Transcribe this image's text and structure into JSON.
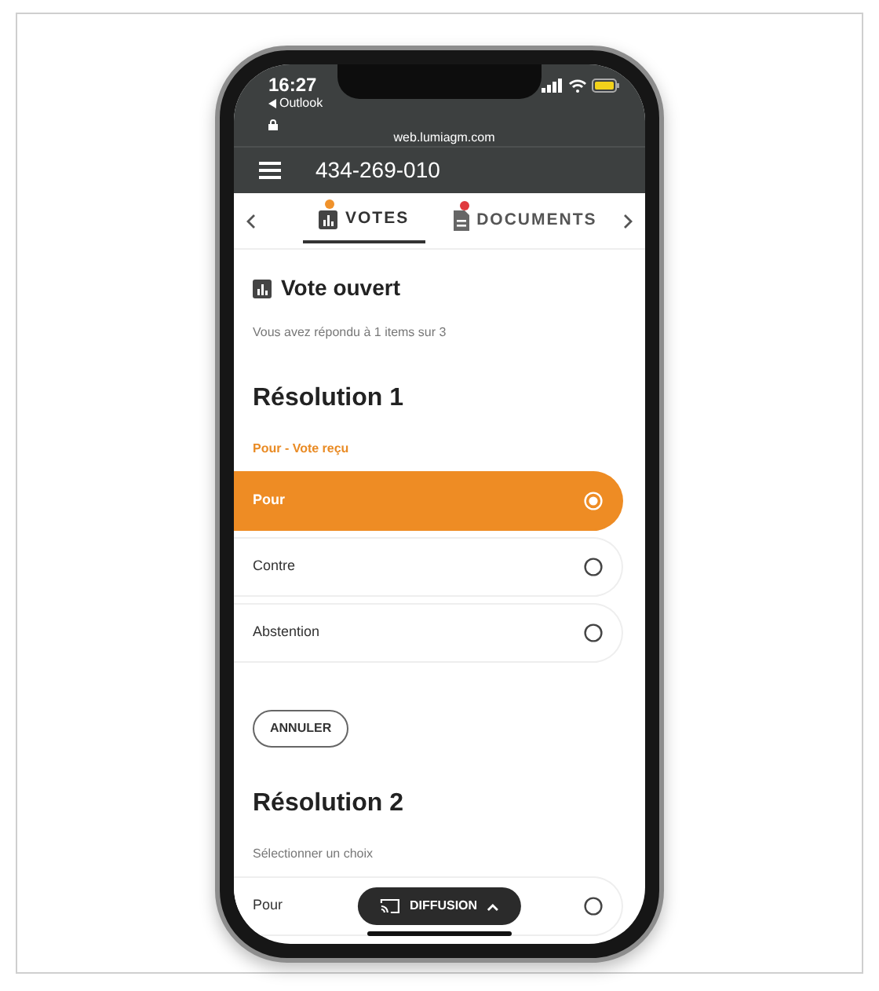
{
  "status_bar": {
    "time": "16:27",
    "back_app": "Outlook",
    "url": "web.lumiagm.com"
  },
  "header": {
    "title": "434-269-010"
  },
  "tabs": [
    {
      "label": "VOTES",
      "selected": true,
      "kind": "votes",
      "color": "#f0922b"
    },
    {
      "label": "DOCUMENTS",
      "selected": false,
      "kind": "documents",
      "color": "#e0393e"
    }
  ],
  "section": {
    "title": "Vote ouvert",
    "progress": "Vous avez répondu à 1 items sur 3"
  },
  "resolutions": [
    {
      "title": "Résolution 1",
      "status": "Pour - Vote reçu",
      "kind": "received",
      "cancel_button": "ANNULER",
      "options": [
        {
          "label": "Pour",
          "selected": true
        },
        {
          "label": "Contre",
          "selected": false
        },
        {
          "label": "Abstention",
          "selected": false
        }
      ]
    },
    {
      "title": "Résolution 2",
      "status": "Sélectionner un choix",
      "kind": "hint",
      "options": [
        {
          "label": "Pour",
          "selected": false
        }
      ]
    }
  ],
  "cast_button": "DIFFUSION"
}
